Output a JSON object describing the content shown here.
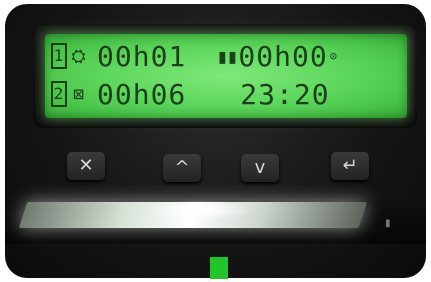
{
  "lcd": {
    "row1": {
      "slot": "1",
      "mode_icon": "driving-icon",
      "mode_glyph": "⛭",
      "time": "00h01",
      "pause_glyph": "▮▮",
      "time2": "00h00",
      "end_glyph": "⊙"
    },
    "row2": {
      "slot": "2",
      "mode_icon": "availability-icon",
      "mode_glyph": "⊠",
      "time": "00h06",
      "clock": "23:20"
    },
    "colors": {
      "backlight": "#5fd85e",
      "text": "#1d3f1a"
    }
  },
  "keys": [
    {
      "icon": "close-icon",
      "glyph": "✕"
    },
    {
      "icon": "up-arrow-icon",
      "glyph": "^"
    },
    {
      "icon": "down-arrow-icon",
      "glyph": "v"
    },
    {
      "icon": "enter-icon",
      "glyph": "↵"
    }
  ],
  "accent": {
    "led_color": "#1ec62a"
  }
}
